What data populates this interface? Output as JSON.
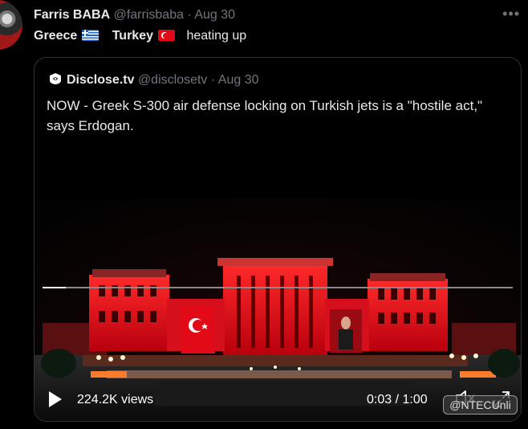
{
  "tweet": {
    "author_name": "Farris BABA",
    "author_handle": "@farrisbaba",
    "separator": "·",
    "date": "Aug 30",
    "more_icon": "more-horizontal-icon",
    "text_part1": "Greece",
    "text_part2": "Turkey",
    "text_part3": "heating up"
  },
  "quote": {
    "author_name": "Disclose.tv",
    "author_handle": "@disclosetv",
    "separator": "·",
    "date": "Aug 30",
    "text": "NOW - Greek S-300 air defense locking on Turkish jets is a \"hostile act,\" says Erdogan."
  },
  "video": {
    "views": "224.2K views",
    "time": "0:03 / 1:00",
    "progress": 0.05,
    "watermark": "@NTECUnli",
    "play_icon": "play-icon",
    "mute_icon": "volume-muted-icon",
    "fullscreen_icon": "fullscreen-icon"
  },
  "colors": {
    "background": "#000000",
    "text": "#e7e9ea",
    "muted": "#71767b",
    "border": "#2f3336",
    "building_red": "#e0111c"
  }
}
